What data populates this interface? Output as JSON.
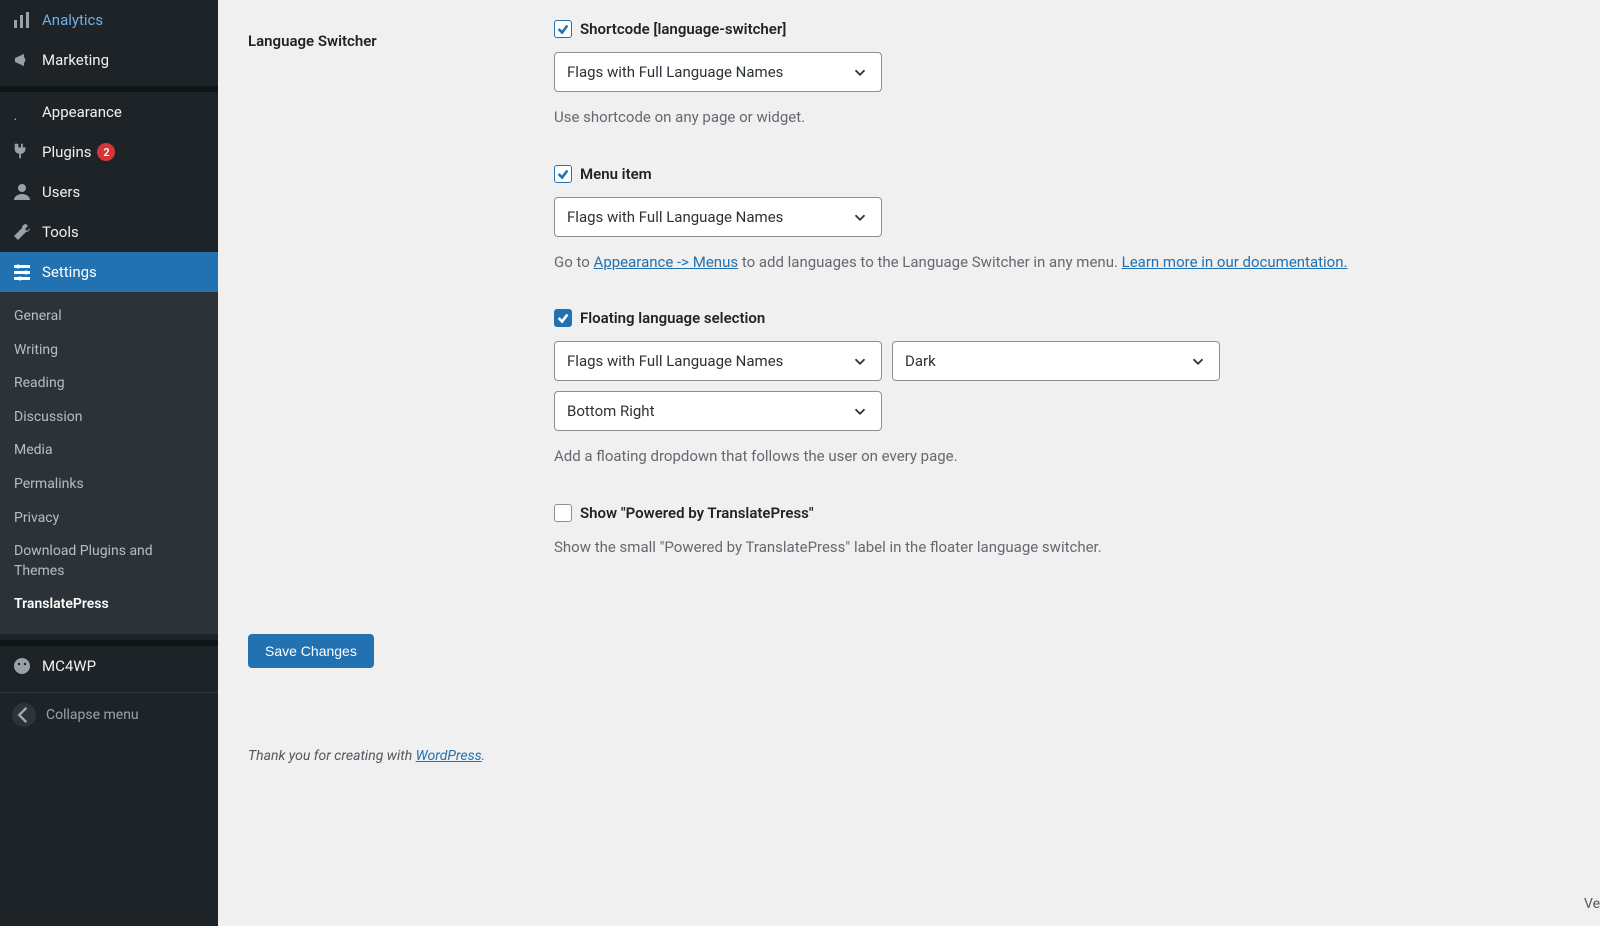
{
  "sidebar": {
    "items": [
      {
        "label": "Analytics",
        "icon": "analytics"
      },
      {
        "label": "Marketing",
        "icon": "marketing"
      },
      {
        "label": "Appearance",
        "icon": "appearance"
      },
      {
        "label": "Plugins",
        "icon": "plugins",
        "badge": "2"
      },
      {
        "label": "Users",
        "icon": "users"
      },
      {
        "label": "Tools",
        "icon": "tools"
      },
      {
        "label": "Settings",
        "icon": "settings",
        "active": true
      },
      {
        "label": "MC4WP",
        "icon": "mc4wp"
      }
    ],
    "submenu": [
      "General",
      "Writing",
      "Reading",
      "Discussion",
      "Media",
      "Permalinks",
      "Privacy",
      "Download Plugins and Themes",
      "TranslatePress"
    ],
    "collapse": "Collapse menu"
  },
  "settings": {
    "section_label": "Language Switcher",
    "shortcode": {
      "label": "Shortcode [language-switcher]",
      "select": "Flags with Full Language Names",
      "desc": "Use shortcode on any page or widget."
    },
    "menu": {
      "label": "Menu item",
      "select": "Flags with Full Language Names",
      "desc_before": "Go to ",
      "link1": "Appearance -> Menus",
      "desc_mid": " to add languages to the Language Switcher in any menu. ",
      "link2": "Learn more in our documentation."
    },
    "floating": {
      "label": "Floating language selection",
      "select1": "Flags with Full Language Names",
      "select2": "Dark",
      "select3": "Bottom Right",
      "desc": "Add a floating dropdown that follows the user on every page."
    },
    "powered": {
      "label": "Show \"Powered by TranslatePress\"",
      "desc": "Show the small \"Powered by TranslatePress\" label in the floater language switcher."
    },
    "save": "Save Changes"
  },
  "footer": {
    "text_before": "Thank you for creating with ",
    "link": "WordPress",
    "text_after": "."
  },
  "ver": "Ve"
}
